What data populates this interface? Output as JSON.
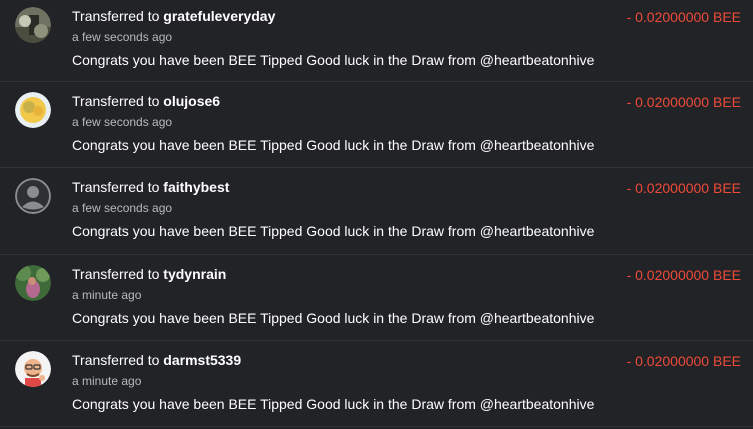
{
  "transfers": [
    {
      "prefix": "Transferred to",
      "user": "gratefuleveryday",
      "time": "a few seconds ago",
      "memo": "Congrats you have been BEE Tipped Good luck in the Draw from @heartbeatonhive",
      "amount": "- 0.02000000 BEE"
    },
    {
      "prefix": "Transferred to",
      "user": "olujose6",
      "time": "a few seconds ago",
      "memo": "Congrats you have been BEE Tipped Good luck in the Draw from @heartbeatonhive",
      "amount": "- 0.02000000 BEE"
    },
    {
      "prefix": "Transferred to",
      "user": "faithybest",
      "time": "a few seconds ago",
      "memo": "Congrats you have been BEE Tipped Good luck in the Draw from @heartbeatonhive",
      "amount": "- 0.02000000 BEE"
    },
    {
      "prefix": "Transferred to",
      "user": "tydynrain",
      "time": "a minute ago",
      "memo": "Congrats you have been BEE Tipped Good luck in the Draw from @heartbeatonhive",
      "amount": "- 0.02000000 BEE"
    },
    {
      "prefix": "Transferred to",
      "user": "darmst5339",
      "time": "a minute ago",
      "memo": "Congrats you have been BEE Tipped Good luck in the Draw from @heartbeatonhive",
      "amount": "- 0.02000000 BEE"
    }
  ],
  "colors": {
    "background": "#222326",
    "divider": "#303236",
    "text": "#ffffff",
    "muted": "#b7b9bd",
    "amount_negative": "#ef4a3a"
  }
}
